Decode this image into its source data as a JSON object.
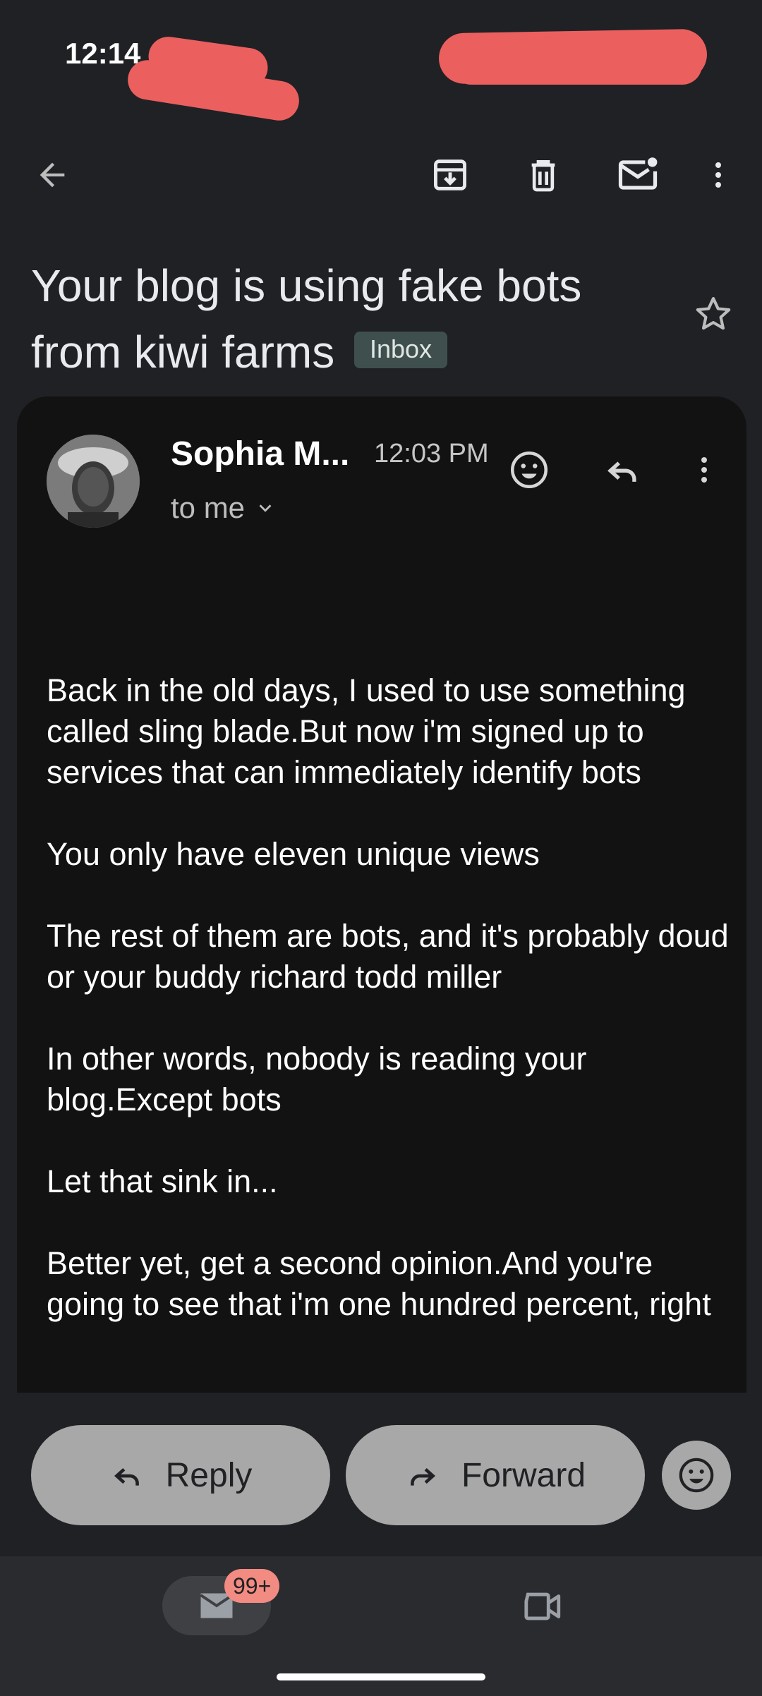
{
  "status_bar": {
    "time": "12:14"
  },
  "icons": {
    "back": "arrow-back-icon",
    "archive": "archive-icon",
    "delete": "trash-icon",
    "mark_unread": "mail-unread-icon",
    "more": "more-vert-icon",
    "star": "star-outline-icon",
    "emoji": "emoji-icon",
    "reply": "reply-icon",
    "forward": "forward-icon",
    "mail": "mail-icon",
    "video": "video-icon"
  },
  "email": {
    "subject": "Your blog is using fake bots from kiwi farms",
    "label": "Inbox",
    "sender": "Sophia M...",
    "time": "12:03 PM",
    "recipient": "to me",
    "body": [
      "Back in the old days, I used to use something called sling blade.But now i'm signed up to services that can immediately identify bots",
      "You only have eleven unique views",
      "The rest of them are bots, and it's probably doud or your buddy richard todd miller",
      "In other words, nobody is reading your blog.Except bots",
      "Let that sink in...",
      "Better yet, get a second opinion.And you're going to see that i'm one hundred percent, right"
    ]
  },
  "actions": {
    "reply": "Reply",
    "forward": "Forward"
  },
  "nav": {
    "mail_badge": "99+"
  },
  "colors": {
    "background": "#202124",
    "card": "#121212",
    "pill": "#a8a8a8",
    "badge": "#f28b82",
    "redaction": "#ec5f5f"
  }
}
